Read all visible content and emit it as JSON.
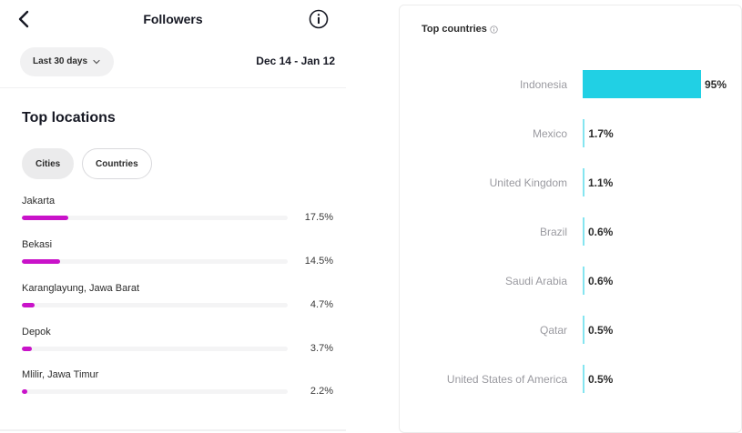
{
  "header": {
    "title": "Followers",
    "range_label": "Last 30 days",
    "date_range": "Dec 14 - Jan 12"
  },
  "top_locations": {
    "title": "Top locations",
    "tabs": [
      {
        "label": "Cities",
        "active": true
      },
      {
        "label": "Countries",
        "active": false
      }
    ],
    "bar_color": "#c913c9",
    "items": [
      {
        "name": "Jakarta",
        "pct": "17.5%",
        "value": 17.5
      },
      {
        "name": "Bekasi",
        "pct": "14.5%",
        "value": 14.5
      },
      {
        "name": "Karanglayung, Jawa Barat",
        "pct": "4.7%",
        "value": 4.7
      },
      {
        "name": "Depok",
        "pct": "3.7%",
        "value": 3.7
      },
      {
        "name": "Mlilir, Jawa Timur",
        "pct": "2.2%",
        "value": 2.2
      }
    ]
  },
  "top_countries": {
    "title": "Top countries",
    "bar_color": "#21d0e4",
    "items": [
      {
        "name": "Indonesia",
        "pct": "95%",
        "value": 95
      },
      {
        "name": "Mexico",
        "pct": "1.7%",
        "value": 1.7
      },
      {
        "name": "United Kingdom",
        "pct": "1.1%",
        "value": 1.1
      },
      {
        "name": "Brazil",
        "pct": "0.6%",
        "value": 0.6
      },
      {
        "name": "Saudi Arabia",
        "pct": "0.6%",
        "value": 0.6
      },
      {
        "name": "Qatar",
        "pct": "0.5%",
        "value": 0.5
      },
      {
        "name": "United States of America",
        "pct": "0.5%",
        "value": 0.5
      }
    ]
  },
  "icons": [
    "back-arrow-icon",
    "info-icon",
    "chevron-down-icon",
    "info-small-icon"
  ]
}
